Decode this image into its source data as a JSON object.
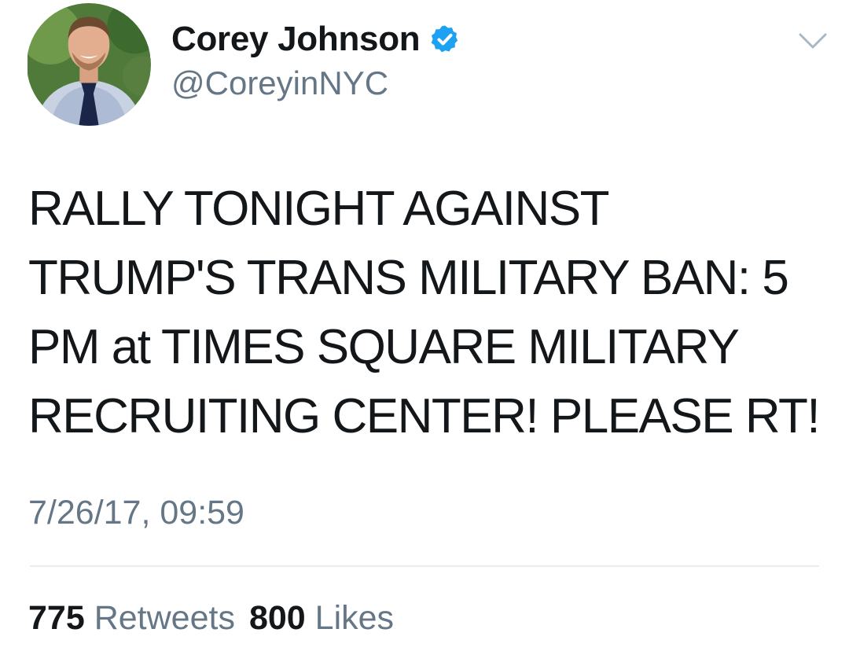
{
  "author": {
    "display_name": "Corey Johnson",
    "handle": "@CoreyinNYC",
    "verified": true,
    "verified_icon": "verified-badge-icon",
    "avatar_icon": "profile-photo"
  },
  "tweet": {
    "text": "RALLY TONIGHT AGAINST TRUMP'S TRANS MILITARY BAN: 5 PM at TIMES SQUARE MILITARY RECRUITING CENTER! PLEASE RT!",
    "timestamp": "7/26/17, 09:59"
  },
  "stats": {
    "retweets_count": "775",
    "retweets_label": "Retweets",
    "likes_count": "800",
    "likes_label": "Likes"
  },
  "menu": {
    "icon": "chevron-down-icon"
  },
  "colors": {
    "text": "#14171a",
    "secondary": "#657786",
    "verified_blue": "#1da1f2",
    "divider": "#e6ecf0"
  }
}
